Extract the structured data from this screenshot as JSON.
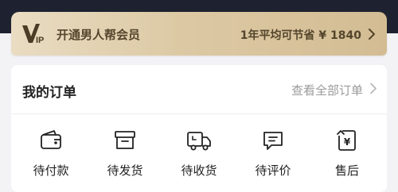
{
  "vip_banner": {
    "logo_text": "VIP",
    "title": "开通男人帮会员",
    "savings": "1年平均可节省 ¥ 1840",
    "icon": "chevron-right-icon"
  },
  "orders": {
    "title": "我的订单",
    "view_all": "查看全部订单",
    "items": [
      {
        "label": "待付款",
        "icon": "wallet-icon"
      },
      {
        "label": "待发货",
        "icon": "box-icon"
      },
      {
        "label": "待收货",
        "icon": "truck-icon"
      },
      {
        "label": "待评价",
        "icon": "comment-icon"
      },
      {
        "label": "售后",
        "icon": "refund-icon"
      }
    ]
  },
  "colors": {
    "header_dark": "#1e2230",
    "vip_gold_start": "#e9dcc2",
    "vip_gold_end": "#d3bc93",
    "vip_text": "#54452c",
    "muted_text": "#9a9a9a"
  }
}
